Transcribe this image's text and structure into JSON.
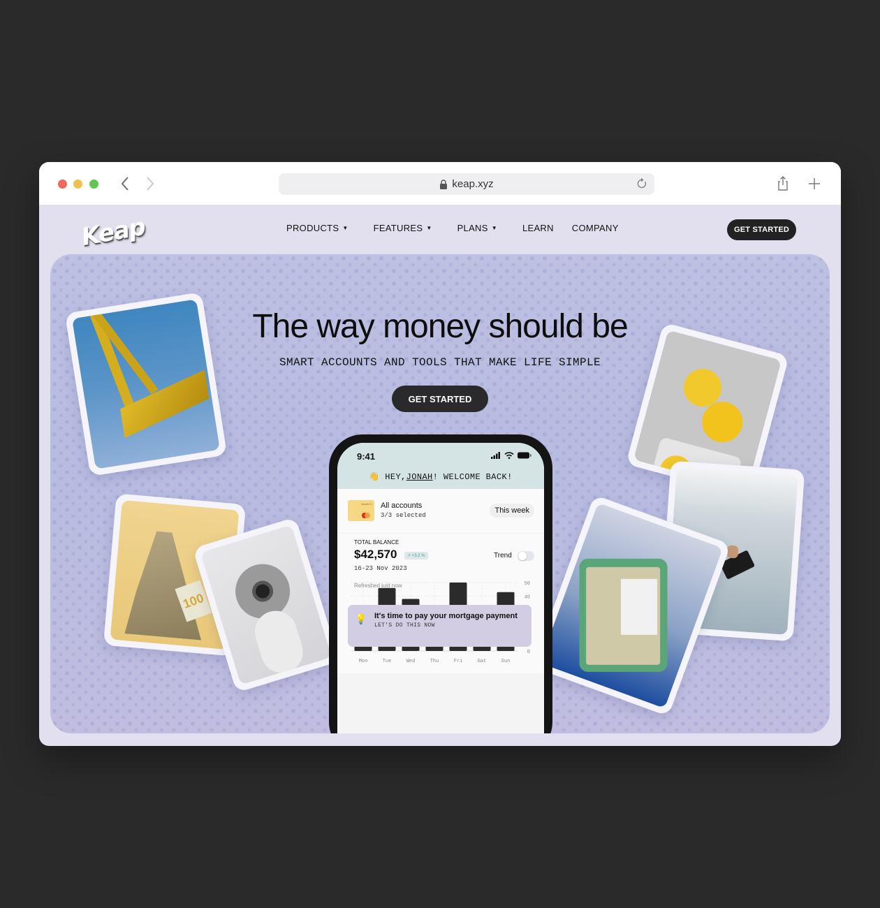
{
  "browser": {
    "url": "keap.xyz",
    "icons": [
      "back-icon",
      "forward-icon",
      "lock-icon",
      "reload-icon",
      "share-icon",
      "new-tab-icon"
    ]
  },
  "site": {
    "logo": "Keap",
    "nav": [
      {
        "label": "PRODUCTS",
        "dropdown": true
      },
      {
        "label": "FEATURES",
        "dropdown": true
      },
      {
        "label": "PLANS",
        "dropdown": true
      },
      {
        "label": "LEARN",
        "dropdown": false
      },
      {
        "label": "COMPANY",
        "dropdown": false
      }
    ],
    "nav_cta": "GET STARTED"
  },
  "hero": {
    "headline": "The way money should be",
    "subhead": "SMART ACCOUNTS AND TOOLS THAT MAKE LIFE SIMPLE",
    "cta": "GET STARTED",
    "photos": [
      "gold bars",
      "folded hundred dollar bills",
      "receipt paper roll",
      "smiley face sticker roll",
      "hand holding phone",
      "cash in green tray"
    ]
  },
  "phone": {
    "time": "9:41",
    "welcome_prefix": "HEY,",
    "user_name": "JONAH",
    "welcome_suffix": "! WELCOME BACK!",
    "card_name": "Jonah H.",
    "accounts_title": "All accounts",
    "accounts_sub": "3/3 selected",
    "period_chip": "This week",
    "balance_label": "TOTAL BALANCE",
    "balance_value": "$42,570",
    "balance_change": "↗ +3.2 %",
    "date_range": "16-23 Nov 2023",
    "trend_label": "Trend",
    "trend_on": false,
    "refreshed": "Refreshed just now",
    "notice_title": "It's time to pay your mortgage payment",
    "notice_sub": "LET'S DO THIS NOW"
  },
  "chart_data": {
    "type": "bar",
    "categories": [
      "Mon",
      "Tue",
      "Wed",
      "Thu",
      "Fri",
      "Sat",
      "Sun"
    ],
    "values": [
      33,
      46,
      38,
      21,
      50,
      28,
      43
    ],
    "ylim": [
      0,
      50
    ],
    "yticks": [
      0,
      10,
      20,
      30,
      40,
      50
    ],
    "grid": true,
    "title": "",
    "xlabel": "",
    "ylabel": "",
    "color": "#2b2b2b"
  }
}
